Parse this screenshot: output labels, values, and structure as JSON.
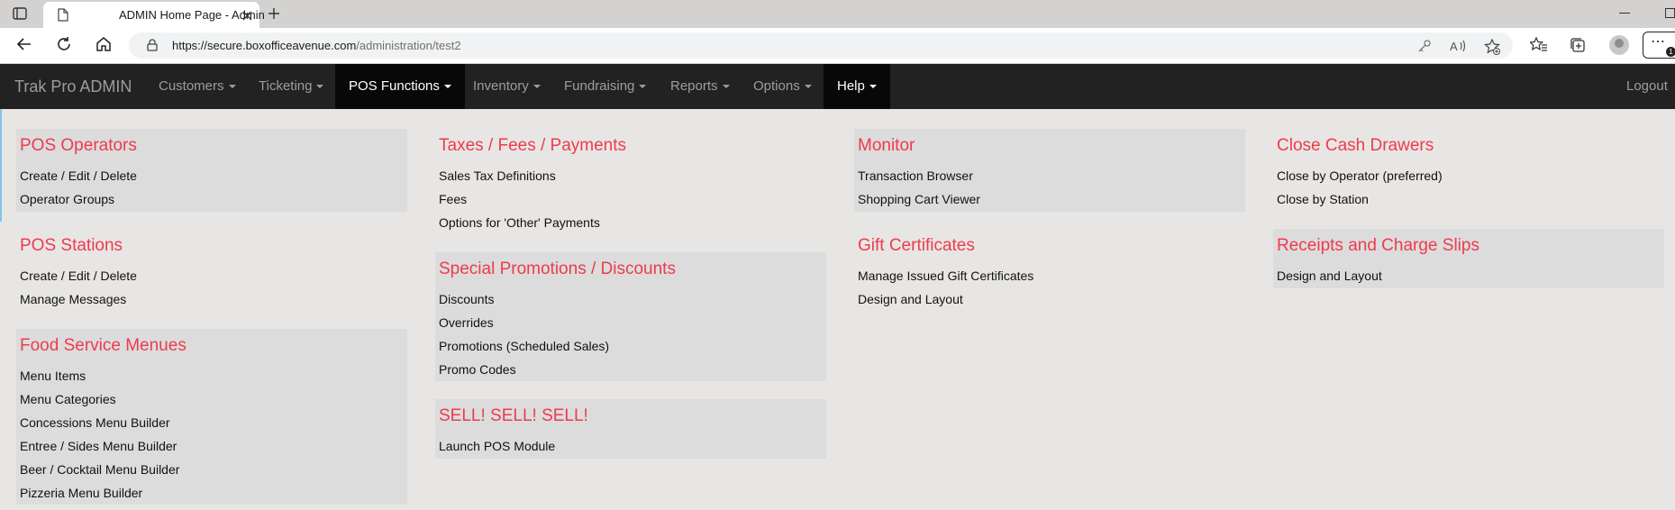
{
  "browser": {
    "tab_title": "ADMIN Home Page - Admin",
    "url_host": "https://secure.boxofficeavenue.com",
    "url_path": "/administration/test2",
    "badge_count": "1"
  },
  "navbar": {
    "brand": "Trak Pro ADMIN",
    "items": [
      {
        "label": "Customers"
      },
      {
        "label": "Ticketing"
      },
      {
        "label": "POS Functions"
      },
      {
        "label": "Inventory"
      },
      {
        "label": "Fundraising"
      },
      {
        "label": "Reports"
      },
      {
        "label": "Options"
      },
      {
        "label": "Help"
      }
    ],
    "logout": "Logout"
  },
  "columns": [
    {
      "panels": [
        {
          "title": "POS Operators",
          "links": [
            "Create / Edit / Delete",
            "Operator Groups"
          ]
        },
        {
          "title": "POS Stations",
          "links": [
            "Create / Edit / Delete",
            "Manage Messages"
          ]
        },
        {
          "title": "Food Service Menues",
          "links": [
            "Menu Items",
            "Menu Categories",
            "Concessions Menu Builder",
            "Entree / Sides Menu Builder",
            "Beer / Cocktail Menu Builder",
            "Pizzeria Menu Builder"
          ]
        }
      ]
    },
    {
      "panels": [
        {
          "title": "Taxes / Fees / Payments",
          "links": [
            "Sales Tax Definitions",
            "Fees",
            "Options for 'Other' Payments"
          ]
        },
        {
          "title": "Special Promotions / Discounts",
          "links": [
            "Discounts",
            "Overrides",
            "Promotions (Scheduled Sales)",
            "Promo Codes"
          ]
        },
        {
          "title": "SELL! SELL! SELL!",
          "links": [
            "Launch POS Module"
          ]
        }
      ]
    },
    {
      "panels": [
        {
          "title": "Monitor",
          "links": [
            "Transaction Browser",
            "Shopping Cart Viewer"
          ]
        },
        {
          "title": "Gift Certificates",
          "links": [
            "Manage Issued Gift Certificates",
            "Design and Layout"
          ]
        }
      ]
    },
    {
      "panels": [
        {
          "title": "Close Cash Drawers",
          "links": [
            "Close by Operator (preferred)",
            "Close by Station"
          ]
        },
        {
          "title": "Receipts and Charge Slips",
          "links": [
            "Design and Layout"
          ]
        }
      ]
    }
  ]
}
